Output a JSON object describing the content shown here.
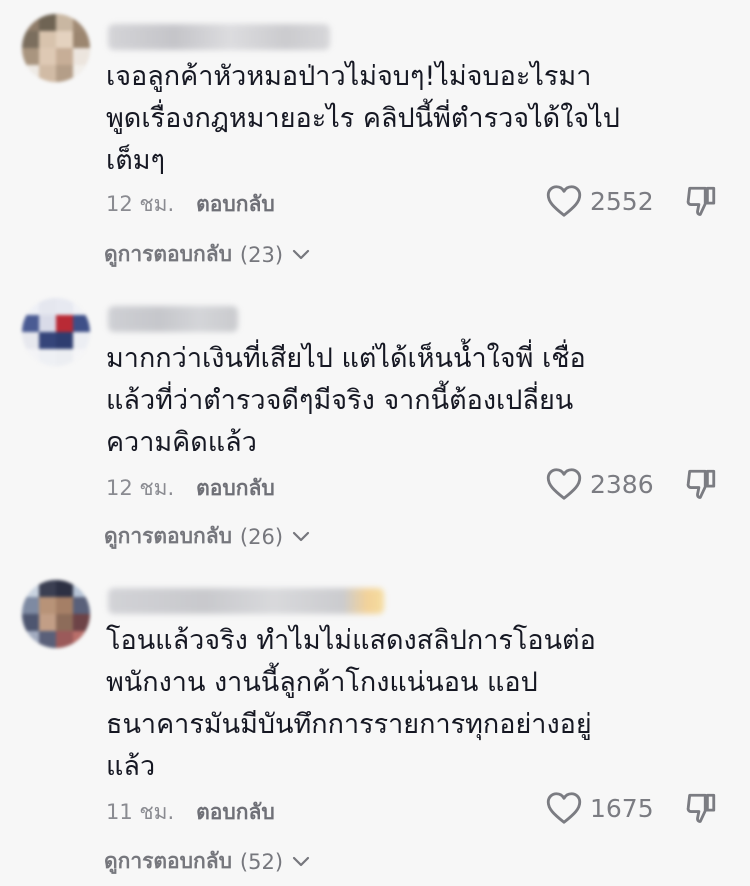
{
  "comments": [
    {
      "text": "เจอลูกค้าหัวหมอป่าวไม่จบๆ!ไม่จบอะไรมา\nพูดเรื่องกฎหมายอะไร คลิปนี้พี่ตำรวจได้ใจไป\nเต็มๆ",
      "time": "12 ชม.",
      "reply_label": "ตอบกลับ",
      "likes": "2552",
      "view_replies_label": "ดูการตอบกลับ",
      "reply_count": "(23)"
    },
    {
      "text": "มากกว่าเงินที่เสียไป แต่ได้เห็นน้ำใจพี่ เชื่อ\nแล้วที่ว่าตำรวจดีๆมีจริง จากนี้ต้องเปลี่ยน\nความคิดแล้ว",
      "time": "12 ชม.",
      "reply_label": "ตอบกลับ",
      "likes": "2386",
      "view_replies_label": "ดูการตอบกลับ",
      "reply_count": "(26)"
    },
    {
      "text": "โอนแล้วจริง ทำไมไม่แสดงสลิปการโอนต่อ\nพนักงาน งานนี้ลูกค้าโกงแน่นอน แอป\nธนาคารมันมีบันทึกการรายการทุกอย่างอยู่\nแล้ว",
      "time": "11 ชม.",
      "reply_label": "ตอบกลับ",
      "likes": "1675",
      "view_replies_label": "ดูการตอบกลับ",
      "reply_count": "(52)"
    }
  ],
  "colors": {
    "background": "#f7f7f7",
    "text": "#161823",
    "secondary_text": "#8a8b91",
    "icon": "#7b7c82"
  },
  "icons": [
    "heart-outline-icon",
    "thumbs-down-icon",
    "chevron-down-icon"
  ]
}
